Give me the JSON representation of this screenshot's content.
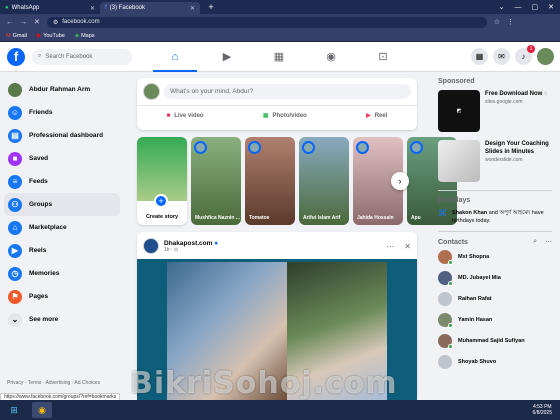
{
  "browser": {
    "tabs": [
      {
        "label": "WhatsApp"
      },
      {
        "label": "(3) Facebook"
      }
    ],
    "url": "facebook.com",
    "bookmarks": [
      {
        "label": "Gmail"
      },
      {
        "label": "YouTube"
      },
      {
        "label": "Maps"
      }
    ]
  },
  "nav": {
    "search_placeholder": "Search Facebook",
    "notification_count": "1"
  },
  "sidebar": {
    "items": [
      {
        "label": "Abdur Rahman Arm",
        "icon": "avatar",
        "color": "#5a7a4a"
      },
      {
        "label": "Friends",
        "icon": "friends-icon",
        "color": "#1877f2"
      },
      {
        "label": "Professional dashboard",
        "icon": "dashboard-icon",
        "color": "#1877f2"
      },
      {
        "label": "Saved",
        "icon": "bookmark-icon",
        "color": "#a033ff"
      },
      {
        "label": "Feeds",
        "icon": "feeds-icon",
        "color": "#1877f2"
      },
      {
        "label": "Groups",
        "icon": "groups-icon",
        "color": "#1877f2"
      },
      {
        "label": "Marketplace",
        "icon": "marketplace-icon",
        "color": "#1877f2"
      },
      {
        "label": "Reels",
        "icon": "reels-icon",
        "color": "#1877f2"
      },
      {
        "label": "Memories",
        "icon": "memories-icon",
        "color": "#1877f2"
      },
      {
        "label": "Pages",
        "icon": "flag-icon",
        "color": "#f0592a"
      },
      {
        "label": "See more",
        "icon": "chevron-down-icon",
        "color": "#e4e6eb"
      }
    ],
    "footer": "Privacy · Terms · Advertising · Ad Choices"
  },
  "composer": {
    "placeholder": "What's on your mind, Abdur?",
    "live": "Live video",
    "photo": "Photo/video",
    "reel": "Reel"
  },
  "stories": {
    "create": "Create story",
    "items": [
      {
        "name": "Mushfica Naznin ...",
        "color": "#7a9a6a"
      },
      {
        "name": "Tomatoe",
        "color": "#8a5a4a"
      },
      {
        "name": "Arifut Islam Arif",
        "color": "#6a8aa0"
      },
      {
        "name": "Jahida Hossain",
        "color": "#c8a090"
      },
      {
        "name": "Apu",
        "color": "#4a8a6a"
      }
    ]
  },
  "post": {
    "author": "Dhakapost.com",
    "time": "1h · ⊙"
  },
  "right": {
    "sponsored_title": "Sponsored",
    "ads": [
      {
        "title": "Free Download Now ◌",
        "url": "sites.google.com",
        "color": "#111111"
      },
      {
        "title": "Design Your Coaching Slides in Minutes",
        "url": "wonderslide.com",
        "color": "#d9d9d9"
      }
    ],
    "birthdays_title": "Birthdays",
    "birthday_text_bold": "Shakon Khan",
    "birthday_text": "and অপুর্ণ আহমেদ have birthdays today.",
    "contacts_title": "Contacts",
    "contacts": [
      {
        "name": "Mst Shopna",
        "color": "#b07050",
        "online": true
      },
      {
        "name": "MD. Jubayel Mia",
        "color": "#506080",
        "online": true
      },
      {
        "name": "Raihan Rafat",
        "color": "#bfc5cc",
        "online": false
      },
      {
        "name": "Yamin Hasan",
        "color": "#7a8a6a",
        "online": true
      },
      {
        "name": "Muhammad Sajid Sufiyan",
        "color": "#8a6a5a",
        "online": true
      },
      {
        "name": "Shoyab Shuvo",
        "color": "#bfc5cc",
        "online": false
      }
    ]
  },
  "status_url": "https://www.facebook.com/groups/?ref=bookmarks",
  "clock": {
    "time": "4:53 PM",
    "date": "6/8/2025"
  },
  "watermark": "BikriSohoj.com"
}
